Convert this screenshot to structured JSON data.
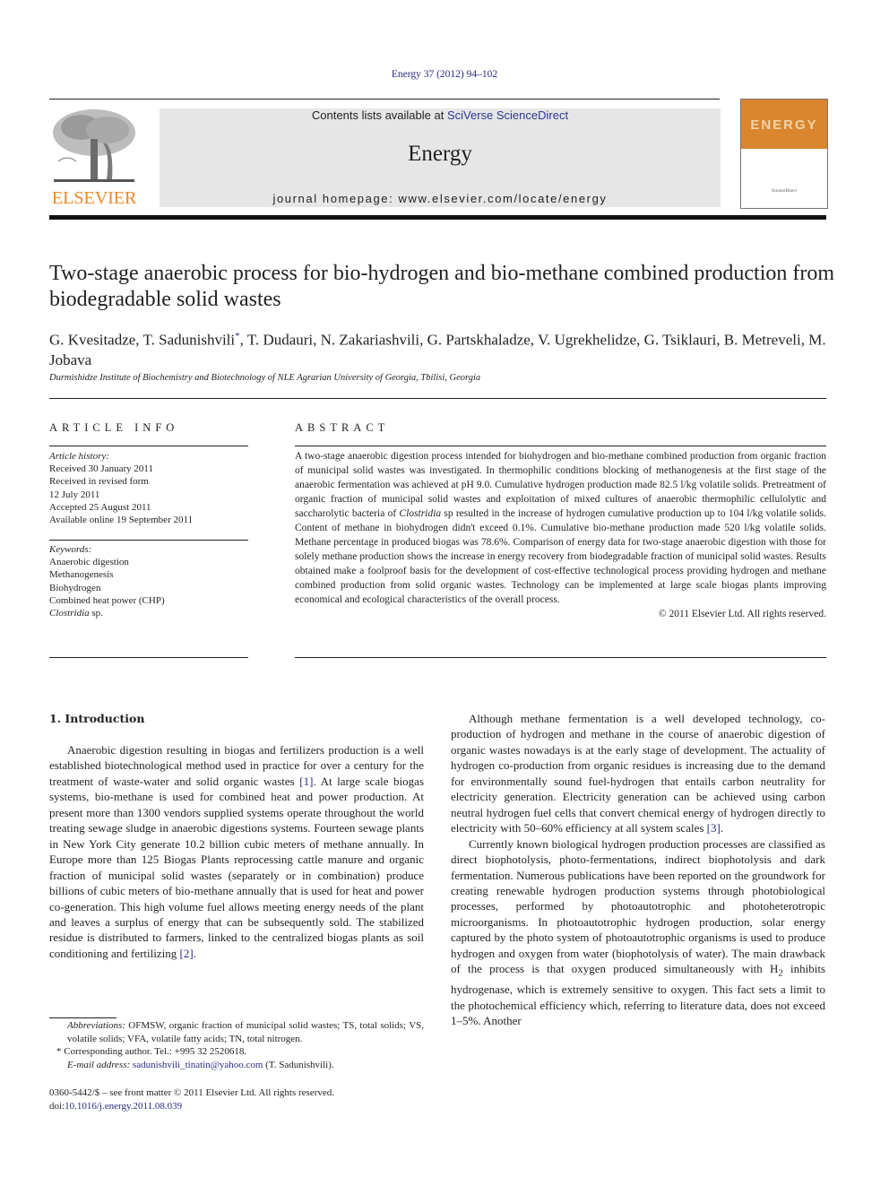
{
  "header": {
    "citation": "Energy 37 (2012) 94–102",
    "publisher_logo_text": "ELSEVIER",
    "contents_prefix": "Contents lists available at ",
    "contents_link": "SciVerse ScienceDirect",
    "journal_name": "Energy",
    "homepage": "journal homepage: www.elsevier.com/locate/energy",
    "cover_title": "ENERGY",
    "colors": {
      "elsevier_orange": "#f08a24",
      "link_blue": "#2b3990",
      "cover_orange": "#d9862f",
      "banner_gray": "#e6e6e6"
    }
  },
  "article": {
    "title": "Two-stage anaerobic process for bio-hydrogen and bio-methane combined production from biodegradable solid wastes",
    "authors_before": "G. Kvesitadze, T. Sadunishvili",
    "corresponding_mark": "*",
    "authors_after": ", T. Dudauri, N. Zakariashvili, G. Partskhaladze, V. Ugrekhelidze, G. Tsiklauri, B. Metreveli, M. Jobava",
    "affiliation": "Durmishidze Institute of Biochemistry and Biotechnology of NLE Agrarian University of Georgia, Tbilisi, Georgia"
  },
  "article_info": {
    "heading": "ARTICLE INFO",
    "history_label": "Article history:",
    "history": [
      "Received 30 January 2011",
      "Received in revised form",
      "12 July 2011",
      "Accepted 25 August 2011",
      "Available online 19 September 2011"
    ],
    "keywords_label": "Keywords:",
    "keywords": [
      "Anaerobic digestion",
      "Methanogenesis",
      "Biohydrogen",
      "Combined heat power (CHP)"
    ],
    "keyword_last_italic": "Clostridia",
    "keyword_last_rest": " sp."
  },
  "abstract": {
    "heading": "ABSTRACT",
    "text_part1": "A two-stage anaerobic digestion process intended for biohydrogen and bio-methane combined production from organic fraction of municipal solid wastes was investigated. In thermophilic conditions blocking of methanogenesis at the first stage of the anaerobic fermentation was achieved at pH 9.0. Cumulative hydrogen production made 82.5 l/kg volatile solids. Pretreatment of organic fraction of municipal solid wastes and exploitation of mixed cultures of anaerobic thermophilic cellulolytic and saccharolytic bacteria of ",
    "text_italic": "Clostridia",
    "text_part2": " sp resulted in the increase of hydrogen cumulative production up to 104 l/kg volatile solids. Content of methane in biohydrogen didn't exceed 0.1%. Cumulative bio-methane production made 520 l/kg volatile solids. Methane percentage in produced biogas was 78.6%. Comparison of energy data for two-stage anaerobic digestion with those for solely methane production shows the increase in energy recovery from biodegradable fraction of municipal solid wastes. Results obtained make a foolproof basis for the development of cost-effective technological process providing hydrogen and methane combined production from solid organic wastes. Technology can be implemented at large scale biogas plants improving economical and ecological characteristics of the overall process.",
    "copyright": "© 2011 Elsevier Ltd. All rights reserved."
  },
  "introduction": {
    "heading": "1.  Introduction",
    "p1_a": "Anaerobic digestion resulting in biogas and fertilizers production is a well established biotechnological method used in practice for over a century for the treatment of waste-water and solid organic wastes ",
    "ref1": "[1]",
    "p1_b": ". At large scale biogas systems, bio-methane is used for combined heat and power production. At present more than 1300 vendors supplied systems operate throughout the world treating sewage sludge in anaerobic digestions systems. Fourteen sewage plants in New York City generate 10.2 billion cubic meters of methane annually. In Europe more than 125 Biogas Plants reprocessing cattle manure and organic fraction of municipal solid wastes (separately or in combination) produce billions of cubic meters of bio-methane annually that is used for heat and power co-generation. This high volume fuel allows meeting energy needs of the plant and leaves a surplus of energy that can be subsequently sold. The stabilized residue is distributed to farmers, linked to the centralized biogas plants as soil conditioning and fertilizing ",
    "ref2": "[2]",
    "p1_c": ".",
    "p2_a": "Although methane fermentation is a well developed technology, co-production of hydrogen and methane in the course of anaerobic digestion of organic wastes nowadays is at the early stage of development. The actuality of hydrogen co-production from organic residues is increasing due to the demand for environmentally sound fuel-hydrogen that entails carbon neutrality for electricity generation. Electricity generation can be achieved using carbon neutral hydrogen fuel cells that convert chemical energy of hydrogen directly to electricity with 50–60% efficiency at all system scales ",
    "ref3": "[3]",
    "p2_b": ".",
    "p3_a": "Currently known biological hydrogen production processes are classified as direct biophotolysis, photo-fermentations, indirect biophotolysis and dark fermentation. Numerous publications have been reported on the groundwork for creating renewable hydrogen production systems through photobiological processes, performed by photoautotrophic and photoheterotropic microorganisms. In photoautotrophic hydrogen production, solar energy captured by the photo system of photoautotrophic organisms is used to produce hydrogen and oxygen from water (biophotolysis of water). The main drawback of the process is that oxygen produced simultaneously with H",
    "p3_sub": "2",
    "p3_b": " inhibits hydrogenase, which is extremely sensitive to oxygen. This fact sets a limit to the photochemical efficiency which, referring to literature data, does not exceed 1–5%. Another"
  },
  "footnotes": {
    "abbrev_label": "Abbreviations:",
    "abbrev_text": " OFMSW, organic fraction of municipal solid wastes; TS, total solids; VS, volatile solids; VFA, volatile fatty acids; TN, total nitrogen.",
    "corresponding": "* Corresponding author. Tel.: +995 32 2520618.",
    "email_label": "E-mail address:",
    "email": "sadunishvili_tinatin@yahoo.com",
    "email_suffix": " (T. Sadunishvili).",
    "front_matter": "0360-5442/$ – see front matter © 2011 Elsevier Ltd. All rights reserved.",
    "doi_prefix": "doi:",
    "doi": "10.1016/j.energy.2011.08.039"
  }
}
